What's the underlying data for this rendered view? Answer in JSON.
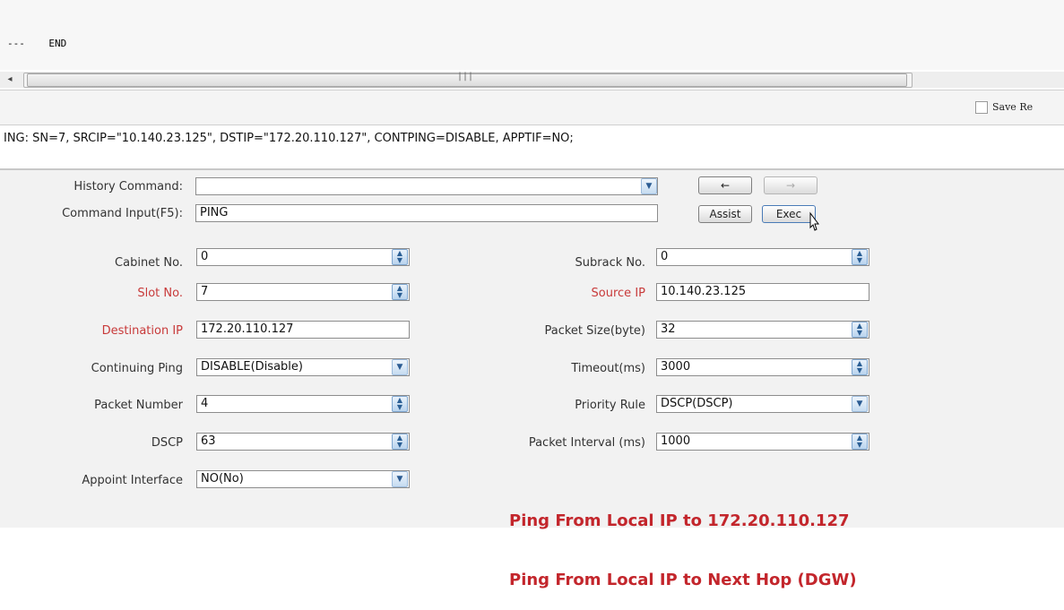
{
  "output": {
    "line": "---    END"
  },
  "scrollbar": {
    "left_arrow": "◂",
    "grip": "|||"
  },
  "save_bar": {
    "label": "Save Re"
  },
  "command_line": "ING: SN=7, SRCIP=\"10.140.23.125\", DSTIP=\"172.20.110.127\", CONTPING=DISABLE, APPTIF=NO;",
  "history": {
    "label": "History Command:",
    "value": ""
  },
  "command_input": {
    "label": "Command Input(F5):",
    "value": "PING"
  },
  "buttons": {
    "back": "←",
    "forward": "→",
    "assist": "Assist",
    "exec": "Exec"
  },
  "fields": {
    "cabinet": {
      "label": "Cabinet No.",
      "value": "0"
    },
    "subrack": {
      "label": "Subrack No.",
      "value": "0"
    },
    "slot": {
      "label": "Slot No.",
      "value": "7"
    },
    "source_ip": {
      "label": "Source IP",
      "value": "10.140.23.125"
    },
    "destination_ip": {
      "label": "Destination IP",
      "value": "172.20.110.127"
    },
    "packet_size": {
      "label": "Packet Size(byte)",
      "value": "32"
    },
    "continuing_ping": {
      "label": "Continuing Ping",
      "value": "DISABLE(Disable)"
    },
    "timeout": {
      "label": "Timeout(ms)",
      "value": "3000"
    },
    "packet_number": {
      "label": "Packet Number",
      "value": "4"
    },
    "priority_rule": {
      "label": "Priority Rule",
      "value": "DSCP(DSCP)"
    },
    "dscp": {
      "label": "DSCP",
      "value": "63"
    },
    "packet_interval": {
      "label": "Packet Interval (ms)",
      "value": "1000"
    },
    "appoint_interface": {
      "label": "Appoint Interface",
      "value": "NO(No)"
    }
  },
  "hint": {
    "line1": "Ping From Local IP to 172.20.110.127",
    "line2": "Ping From Local IP to Next Hop (DGW)"
  },
  "icons": {
    "spin": "spinner-icon",
    "dropdown": "chevron-down-icon",
    "cursor": "mouse-cursor-icon"
  },
  "colors": {
    "required_label": "#c83a3a",
    "hint_text": "#c3262c"
  }
}
